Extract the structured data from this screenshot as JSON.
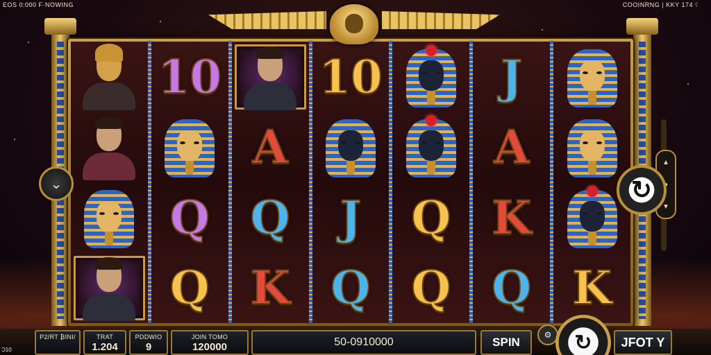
{
  "header": {
    "top_left": "EOS 0:000 F·NOWING",
    "top_right_label": "COOINRNG | KKY",
    "top_right_value": "174",
    "top_right_accent": "ʕ"
  },
  "reels": [
    [
      {
        "type": "bust",
        "variant": "gold",
        "name": "purple-pharaoh-bust-icon"
      },
      {
        "type": "bust",
        "variant": "scarf",
        "name": "egyptian-noble-icon"
      },
      {
        "type": "pharaoh",
        "face": "gold",
        "name": "pharaoh-mask-icon"
      },
      {
        "type": "person",
        "framed": true,
        "name": "young-man-portrait-icon"
      }
    ],
    [
      {
        "type": "letter",
        "text": "10",
        "color": "purple"
      },
      {
        "type": "pharaoh",
        "face": "gold",
        "name": "pharaoh-mask-icon"
      },
      {
        "type": "letter",
        "text": "Q",
        "color": "purple"
      },
      {
        "type": "letter",
        "text": "Q",
        "color": "gold"
      }
    ],
    [
      {
        "type": "person",
        "framed": true,
        "name": "man-portrait-icon"
      },
      {
        "type": "letter",
        "text": "A",
        "color": "red"
      },
      {
        "type": "letter",
        "text": "Q",
        "color": "blue"
      },
      {
        "type": "letter",
        "text": "K",
        "color": "red"
      }
    ],
    [
      {
        "type": "letter",
        "text": "10",
        "color": "gold"
      },
      {
        "type": "pharaoh",
        "face": "dark",
        "name": "dark-pharaoh-icon"
      },
      {
        "type": "letter",
        "text": "J",
        "color": "blue"
      },
      {
        "type": "letter",
        "text": "Q",
        "color": "blue"
      }
    ],
    [
      {
        "type": "pharaoh",
        "face": "dark",
        "gem": true,
        "name": "jeweled-pharaoh-icon"
      },
      {
        "type": "pharaoh",
        "face": "dark",
        "gem": true,
        "name": "jeweled-pharaoh-icon"
      },
      {
        "type": "letter",
        "text": "Q",
        "color": "gold"
      },
      {
        "type": "letter",
        "text": "Q",
        "color": "gold"
      }
    ],
    [
      {
        "type": "letter",
        "text": "J",
        "color": "blue"
      },
      {
        "type": "letter",
        "text": "A",
        "color": "red"
      },
      {
        "type": "letter",
        "text": "K",
        "color": "red"
      },
      {
        "type": "letter",
        "text": "Q",
        "color": "blue"
      }
    ],
    [
      {
        "type": "pharaoh",
        "face": "gold",
        "name": "pharaoh-mask-icon"
      },
      {
        "type": "pharaoh",
        "face": "gold",
        "name": "pharaoh-mask-icon"
      },
      {
        "type": "pharaoh",
        "face": "dark",
        "gem": true,
        "name": "jeweled-pharaoh-icon"
      },
      {
        "type": "letter",
        "text": "K",
        "color": "gold"
      }
    ]
  ],
  "bottom": {
    "p1_label": "P2/RT ₿INI/",
    "p1_value": "",
    "p2_label": "TRAT",
    "p2_value": "1.204",
    "p3_label": "PDDWIO",
    "p3_value": "9",
    "p4_label": "JOIN TOMO",
    "p4_value": "120000",
    "p5_value": "50-0910000",
    "spin_label": "SPIN",
    "auto_label": "JFOT Y"
  },
  "corner_bottom_left": "Ɔ10",
  "colors": {
    "gold": "#f6c14e",
    "purple": "#c679e6",
    "red": "#e24a3b",
    "blue": "#4db3e8",
    "frame": "#caa04a"
  }
}
